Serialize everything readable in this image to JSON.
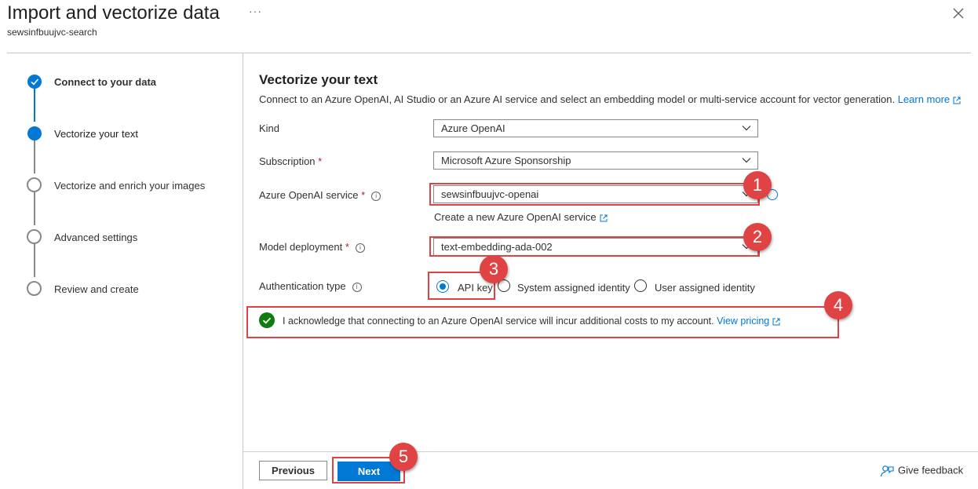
{
  "header": {
    "title": "Import and vectorize data",
    "subtitle": "sewsinfbuujvc-search",
    "more_label": "···"
  },
  "steps": [
    {
      "label": "Connect to your data",
      "state": "completed"
    },
    {
      "label": "Vectorize your text",
      "state": "current"
    },
    {
      "label": "Vectorize and enrich your images",
      "state": "pending"
    },
    {
      "label": "Advanced settings",
      "state": "pending"
    },
    {
      "label": "Review and create",
      "state": "pending"
    }
  ],
  "section": {
    "title": "Vectorize your text",
    "description": "Connect to an Azure OpenAI, AI Studio or an Azure AI service and select an embedding model or multi-service account for vector generation.",
    "learn_more": "Learn more"
  },
  "form": {
    "kind": {
      "label": "Kind",
      "value": "Azure OpenAI"
    },
    "subscription": {
      "label": "Subscription",
      "required": "*",
      "value": "Microsoft Azure Sponsorship"
    },
    "service": {
      "label": "Azure OpenAI service",
      "required": "*",
      "value": "sewsinfbuujvc-openai",
      "create_link": "Create a new Azure OpenAI service"
    },
    "model": {
      "label": "Model deployment",
      "required": "*",
      "value": "text-embedding-ada-002"
    },
    "auth": {
      "label": "Authentication type",
      "options": [
        "API key",
        "System assigned identity",
        "User assigned identity"
      ],
      "selected": "API key"
    },
    "acknowledge": {
      "text": "I acknowledge that connecting to an Azure OpenAI service will incur additional costs to my account.",
      "link": "View pricing",
      "checked": true
    }
  },
  "callouts": [
    "1",
    "2",
    "3",
    "4",
    "5"
  ],
  "footer": {
    "previous": "Previous",
    "next": "Next",
    "feedback": "Give feedback"
  },
  "colors": {
    "accent": "#0078d4",
    "callout": "#e04343",
    "success": "#107c10"
  }
}
